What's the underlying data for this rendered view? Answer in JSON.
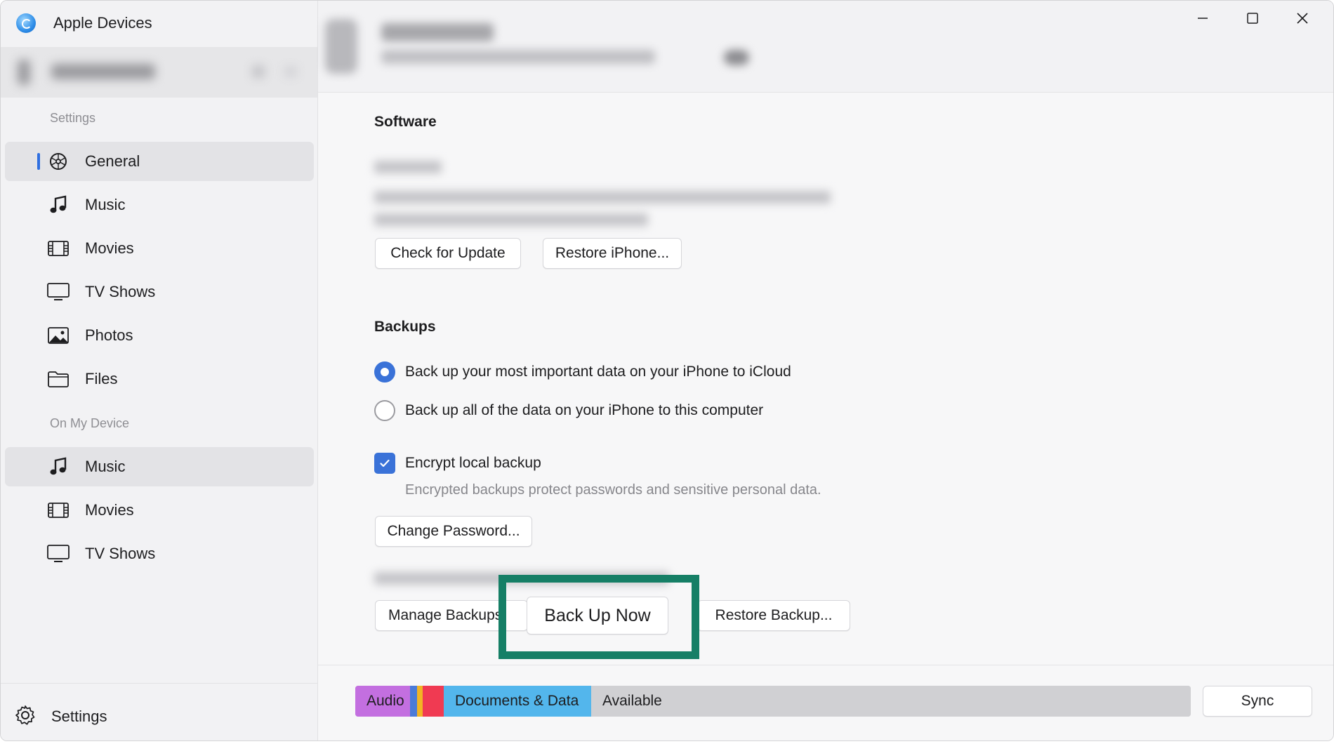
{
  "app": {
    "title": "Apple Devices"
  },
  "sidebar": {
    "settings_heading": "Settings",
    "settings_items": [
      {
        "label": "General",
        "icon": "general-icon",
        "selected": true
      },
      {
        "label": "Music",
        "icon": "music-note-icon",
        "selected": false
      },
      {
        "label": "Movies",
        "icon": "film-icon",
        "selected": false
      },
      {
        "label": "TV Shows",
        "icon": "tv-icon",
        "selected": false
      },
      {
        "label": "Photos",
        "icon": "photo-icon",
        "selected": false
      },
      {
        "label": "Files",
        "icon": "folder-icon",
        "selected": false
      }
    ],
    "device_heading": "On My Device",
    "device_items": [
      {
        "label": "Music",
        "icon": "music-note-icon",
        "selected": true
      },
      {
        "label": "Movies",
        "icon": "film-icon",
        "selected": false
      },
      {
        "label": "TV Shows",
        "icon": "tv-icon",
        "selected": false
      }
    ],
    "footer_label": "Settings"
  },
  "software": {
    "title": "Software",
    "check_update_label": "Check for Update",
    "restore_label": "Restore iPhone..."
  },
  "backups": {
    "title": "Backups",
    "option_icloud": "Back up your most important data on your iPhone to iCloud",
    "option_computer": "Back up all of the data on your iPhone to this computer",
    "selected_option": "icloud",
    "encrypt_label": "Encrypt local backup",
    "encrypt_checked": true,
    "encrypt_helper": "Encrypted backups protect passwords and sensitive personal data.",
    "change_password_label": "Change Password...",
    "manage_label": "Manage Backups",
    "backup_now_label": "Back Up Now",
    "restore_backup_label": "Restore Backup..."
  },
  "storage_bar": {
    "segments": [
      {
        "label": "Audio",
        "color": "#c36fe0"
      },
      {
        "label": "Documents & Data",
        "color": "#53b6ec"
      },
      {
        "label": "Available",
        "color": "#d0d0d3"
      }
    ]
  },
  "sync_label": "Sync",
  "colors": {
    "accent": "#3a72d8",
    "highlight": "#167f66"
  }
}
